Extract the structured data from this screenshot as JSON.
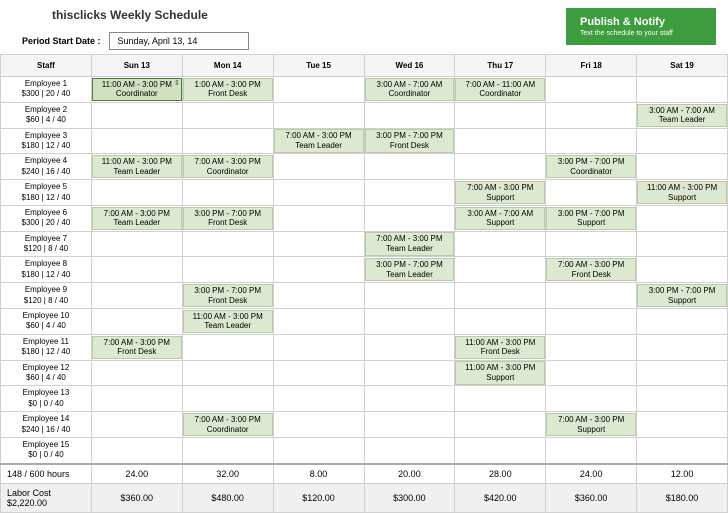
{
  "header": {
    "title": "thisclicks Weekly Schedule",
    "period_label": "Period Start Date :",
    "period_value": "Sunday, April 13, 14",
    "publish_title": "Publish & Notify",
    "publish_sub": "Text the schedule to your staff"
  },
  "columns": [
    "Staff",
    "Sun 13",
    "Mon 14",
    "Tue 15",
    "Wed 16",
    "Thu 17",
    "Fri 18",
    "Sat 19"
  ],
  "employees": [
    {
      "name": "Employee 1",
      "stats": "$300 | 20 / 40",
      "shifts": [
        {
          "day": 0,
          "time": "11:00 AM - 3:00 PM",
          "role": "Coordinator",
          "selected": true
        },
        {
          "day": 1,
          "time": "1:00 AM - 3:00 PM",
          "role": "Front Desk"
        },
        {
          "day": 3,
          "time": "3:00 AM - 7:00 AM",
          "role": "Coordinator"
        },
        {
          "day": 4,
          "time": "7:00 AM - 11:00 AM",
          "role": "Coordinator"
        }
      ]
    },
    {
      "name": "Employee 2",
      "stats": "$60 | 4 / 40",
      "shifts": [
        {
          "day": 6,
          "time": "3:00 AM - 7:00 AM",
          "role": "Team Leader"
        }
      ]
    },
    {
      "name": "Employee 3",
      "stats": "$180 | 12 / 40",
      "shifts": [
        {
          "day": 2,
          "time": "7:00 AM - 3:00 PM",
          "role": "Team Leader"
        },
        {
          "day": 3,
          "time": "3:00 PM - 7:00 PM",
          "role": "Front Desk"
        }
      ]
    },
    {
      "name": "Employee 4",
      "stats": "$240 | 16 / 40",
      "shifts": [
        {
          "day": 0,
          "time": "11:00 AM - 3:00 PM",
          "role": "Team Leader"
        },
        {
          "day": 1,
          "time": "7:00 AM - 3:00 PM",
          "role": "Coordinator"
        },
        {
          "day": 5,
          "time": "3:00 PM - 7:00 PM",
          "role": "Coordinator"
        }
      ]
    },
    {
      "name": "Employee 5",
      "stats": "$180 | 12 / 40",
      "shifts": [
        {
          "day": 4,
          "time": "7:00 AM - 3:00 PM",
          "role": "Support"
        },
        {
          "day": 6,
          "time": "11:00 AM - 3:00 PM",
          "role": "Support"
        }
      ]
    },
    {
      "name": "Employee 6",
      "stats": "$300 | 20 / 40",
      "shifts": [
        {
          "day": 0,
          "time": "7:00 AM - 3:00 PM",
          "role": "Team Leader"
        },
        {
          "day": 1,
          "time": "3:00 PM - 7:00 PM",
          "role": "Front Desk"
        },
        {
          "day": 4,
          "time": "3:00 AM - 7:00 AM",
          "role": "Support"
        },
        {
          "day": 5,
          "time": "3:00 PM - 7:00 PM",
          "role": "Support"
        }
      ]
    },
    {
      "name": "Employee 7",
      "stats": "$120 | 8 / 40",
      "shifts": [
        {
          "day": 3,
          "time": "7:00 AM - 3:00 PM",
          "role": "Team Leader"
        }
      ]
    },
    {
      "name": "Employee 8",
      "stats": "$180 | 12 / 40",
      "shifts": [
        {
          "day": 3,
          "time": "3:00 PM - 7:00 PM",
          "role": "Team Leader"
        },
        {
          "day": 5,
          "time": "7:00 AM - 3:00 PM",
          "role": "Front Desk"
        }
      ]
    },
    {
      "name": "Employee 9",
      "stats": "$120 | 8 / 40",
      "shifts": [
        {
          "day": 1,
          "time": "3:00 PM - 7:00 PM",
          "role": "Front Desk"
        },
        {
          "day": 6,
          "time": "3:00 PM - 7:00 PM",
          "role": "Support"
        }
      ]
    },
    {
      "name": "Employee 10",
      "stats": "$60 | 4 / 40",
      "shifts": [
        {
          "day": 1,
          "time": "11:00 AM - 3:00 PM",
          "role": "Team Leader"
        }
      ]
    },
    {
      "name": "Employee 11",
      "stats": "$180 | 12 / 40",
      "shifts": [
        {
          "day": 0,
          "time": "7:00 AM - 3:00 PM",
          "role": "Front Desk"
        },
        {
          "day": 4,
          "time": "11:00 AM - 3:00 PM",
          "role": "Front Desk"
        }
      ]
    },
    {
      "name": "Employee 12",
      "stats": "$60 | 4 / 40",
      "shifts": [
        {
          "day": 4,
          "time": "11:00 AM - 3:00 PM",
          "role": "Support"
        }
      ]
    },
    {
      "name": "Employee 13",
      "stats": "$0 | 0 / 40",
      "shifts": []
    },
    {
      "name": "Employee 14",
      "stats": "$240 | 16 / 40",
      "shifts": [
        {
          "day": 1,
          "time": "7:00 AM - 3:00 PM",
          "role": "Coordinator"
        },
        {
          "day": 5,
          "time": "7:00 AM - 3:00 PM",
          "role": "Support"
        }
      ]
    },
    {
      "name": "Employee 15",
      "stats": "$0 | 0 / 40",
      "shifts": []
    }
  ],
  "footer": {
    "hours_label": "148 / 600 hours",
    "hours": [
      "24.00",
      "32.00",
      "8.00",
      "20.00",
      "28.00",
      "24.00",
      "12.00"
    ],
    "labor_label": "Labor Cost $2,220.00",
    "labor": [
      "$360.00",
      "$480.00",
      "$120.00",
      "$300.00",
      "$420.00",
      "$360.00",
      "$180.00"
    ]
  }
}
